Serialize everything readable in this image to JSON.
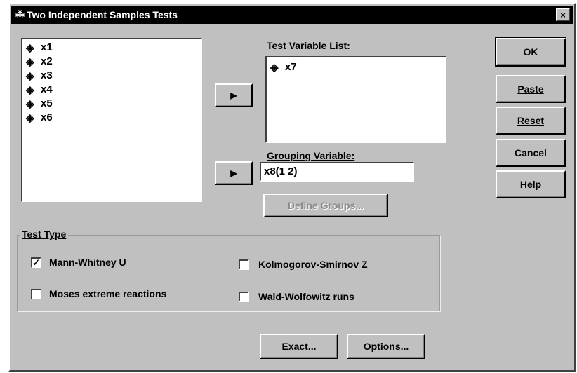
{
  "window": {
    "title": "Two Independent Samples Tests",
    "title_icon": "⁂",
    "close_glyph": "×"
  },
  "source_list": {
    "icon": "ruler-icon",
    "items": [
      "x1",
      "x2",
      "x3",
      "x4",
      "x5",
      "x6"
    ]
  },
  "test_variable_list": {
    "label": "Test Variable List:",
    "items": [
      "x7"
    ]
  },
  "grouping": {
    "label": "Grouping Variable:",
    "value": "x8(1 2)",
    "define_groups_label": "Define Groups..."
  },
  "arrows": {
    "move_test_var": "▶",
    "move_grouping_var": "▶"
  },
  "buttons": {
    "ok": "OK",
    "paste": "Paste",
    "reset": "Reset",
    "cancel": "Cancel",
    "help": "Help",
    "exact": "Exact...",
    "options": "Options..."
  },
  "test_type": {
    "legend": "Test Type",
    "mann_whitney": {
      "label": "Mann-Whitney U",
      "checked": true
    },
    "moses": {
      "label": "Moses extreme reactions",
      "checked": false
    },
    "kolmogorov": {
      "label": "Kolmogorov-Smirnov Z",
      "checked": false
    },
    "wald": {
      "label": "Wald-Wolfowitz runs",
      "checked": false
    },
    "check_glyph": "✓"
  }
}
